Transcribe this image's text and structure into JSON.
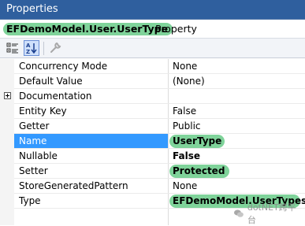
{
  "window": {
    "title": "Properties"
  },
  "selected_object": {
    "name": "EFDemoModel.User.UserType",
    "kind": "Property"
  },
  "toolbar": {
    "buttons": [
      {
        "icon": "categorized-icon",
        "active": false
      },
      {
        "icon": "alphabetical-sort-icon",
        "active": true
      },
      {
        "icon": "property-pages-wrench-icon",
        "active": false,
        "enabled": false
      }
    ]
  },
  "properties": [
    {
      "name": "Concurrency Mode",
      "value": "None"
    },
    {
      "name": "Default Value",
      "value": "(None)"
    },
    {
      "name": "Documentation",
      "value": "",
      "expandable": true
    },
    {
      "name": "Entity Key",
      "value": "False"
    },
    {
      "name": "Getter",
      "value": "Public"
    },
    {
      "name": "Name",
      "value": "UserType",
      "selected": true,
      "highlight": true,
      "bold": true
    },
    {
      "name": "Nullable",
      "value": "False",
      "bold": true
    },
    {
      "name": "Setter",
      "value": "Protected",
      "highlight": true,
      "bold": true
    },
    {
      "name": "StoreGeneratedPattern",
      "value": "None"
    },
    {
      "name": "Type",
      "value": "EFDemoModel.UserTypes",
      "highlight": true,
      "bold": true
    }
  ],
  "colors": {
    "title_bar": "#2f5f9e",
    "selection": "#3399ff",
    "highlight_marker": "#7fd39a"
  },
  "watermark": {
    "text": "dotNET跨平台"
  }
}
